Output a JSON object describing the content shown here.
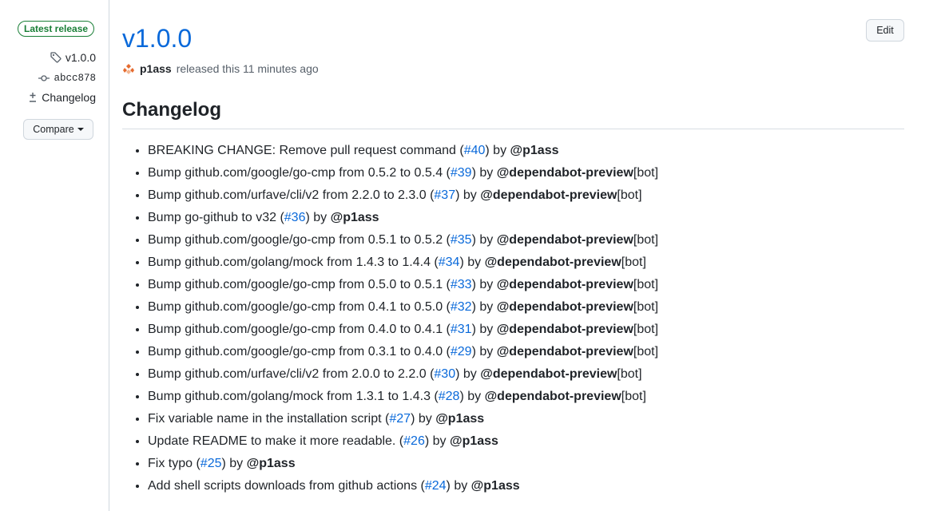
{
  "sidebar": {
    "latest_badge": "Latest release",
    "tag": "v1.0.0",
    "commit": "abcc878",
    "changelog_link": "Changelog",
    "compare_label": "Compare"
  },
  "release": {
    "title": "v1.0.0",
    "edit_label": "Edit",
    "author": "p1ass",
    "released_text": "released this 11 minutes ago"
  },
  "changelog": {
    "heading": "Changelog",
    "entries": [
      {
        "text": "BREAKING CHANGE: Remove pull request command",
        "pr": "#40",
        "user": "@p1ass",
        "suffix": ""
      },
      {
        "text": "Bump github.com/google/go-cmp from 0.5.2 to 0.5.4",
        "pr": "#39",
        "user": "@dependabot-preview",
        "suffix": "[bot]"
      },
      {
        "text": "Bump github.com/urfave/cli/v2 from 2.2.0 to 2.3.0",
        "pr": "#37",
        "user": "@dependabot-preview",
        "suffix": "[bot]"
      },
      {
        "text": "Bump go-github to v32",
        "pr": "#36",
        "user": "@p1ass",
        "suffix": ""
      },
      {
        "text": "Bump github.com/google/go-cmp from 0.5.1 to 0.5.2",
        "pr": "#35",
        "user": "@dependabot-preview",
        "suffix": "[bot]"
      },
      {
        "text": "Bump github.com/golang/mock from 1.4.3 to 1.4.4",
        "pr": "#34",
        "user": "@dependabot-preview",
        "suffix": "[bot]"
      },
      {
        "text": "Bump github.com/google/go-cmp from 0.5.0 to 0.5.1",
        "pr": "#33",
        "user": "@dependabot-preview",
        "suffix": "[bot]"
      },
      {
        "text": "Bump github.com/google/go-cmp from 0.4.1 to 0.5.0",
        "pr": "#32",
        "user": "@dependabot-preview",
        "suffix": "[bot]"
      },
      {
        "text": "Bump github.com/google/go-cmp from 0.4.0 to 0.4.1",
        "pr": "#31",
        "user": "@dependabot-preview",
        "suffix": "[bot]"
      },
      {
        "text": "Bump github.com/google/go-cmp from 0.3.1 to 0.4.0",
        "pr": "#29",
        "user": "@dependabot-preview",
        "suffix": "[bot]"
      },
      {
        "text": "Bump github.com/urfave/cli/v2 from 2.0.0 to 2.2.0",
        "pr": "#30",
        "user": "@dependabot-preview",
        "suffix": "[bot]"
      },
      {
        "text": "Bump github.com/golang/mock from 1.3.1 to 1.4.3",
        "pr": "#28",
        "user": "@dependabot-preview",
        "suffix": "[bot]"
      },
      {
        "text": "Fix variable name in the installation script",
        "pr": "#27",
        "user": "@p1ass",
        "suffix": ""
      },
      {
        "text": "Update README to make it more readable.",
        "pr": "#26",
        "user": "@p1ass",
        "suffix": ""
      },
      {
        "text": "Fix typo",
        "pr": "#25",
        "user": "@p1ass",
        "suffix": ""
      },
      {
        "text": "Add shell scripts downloads from github actions",
        "pr": "#24",
        "user": "@p1ass",
        "suffix": ""
      }
    ]
  },
  "icons": {
    "tag": "tag-icon",
    "commit": "git-commit-icon",
    "diff": "file-diff-icon",
    "avatar": "user-avatar"
  },
  "colors": {
    "link": "#0969da",
    "badge_green": "#1a7f37",
    "text": "#1f2328",
    "muted": "#57606a",
    "border": "#d0d7de"
  }
}
